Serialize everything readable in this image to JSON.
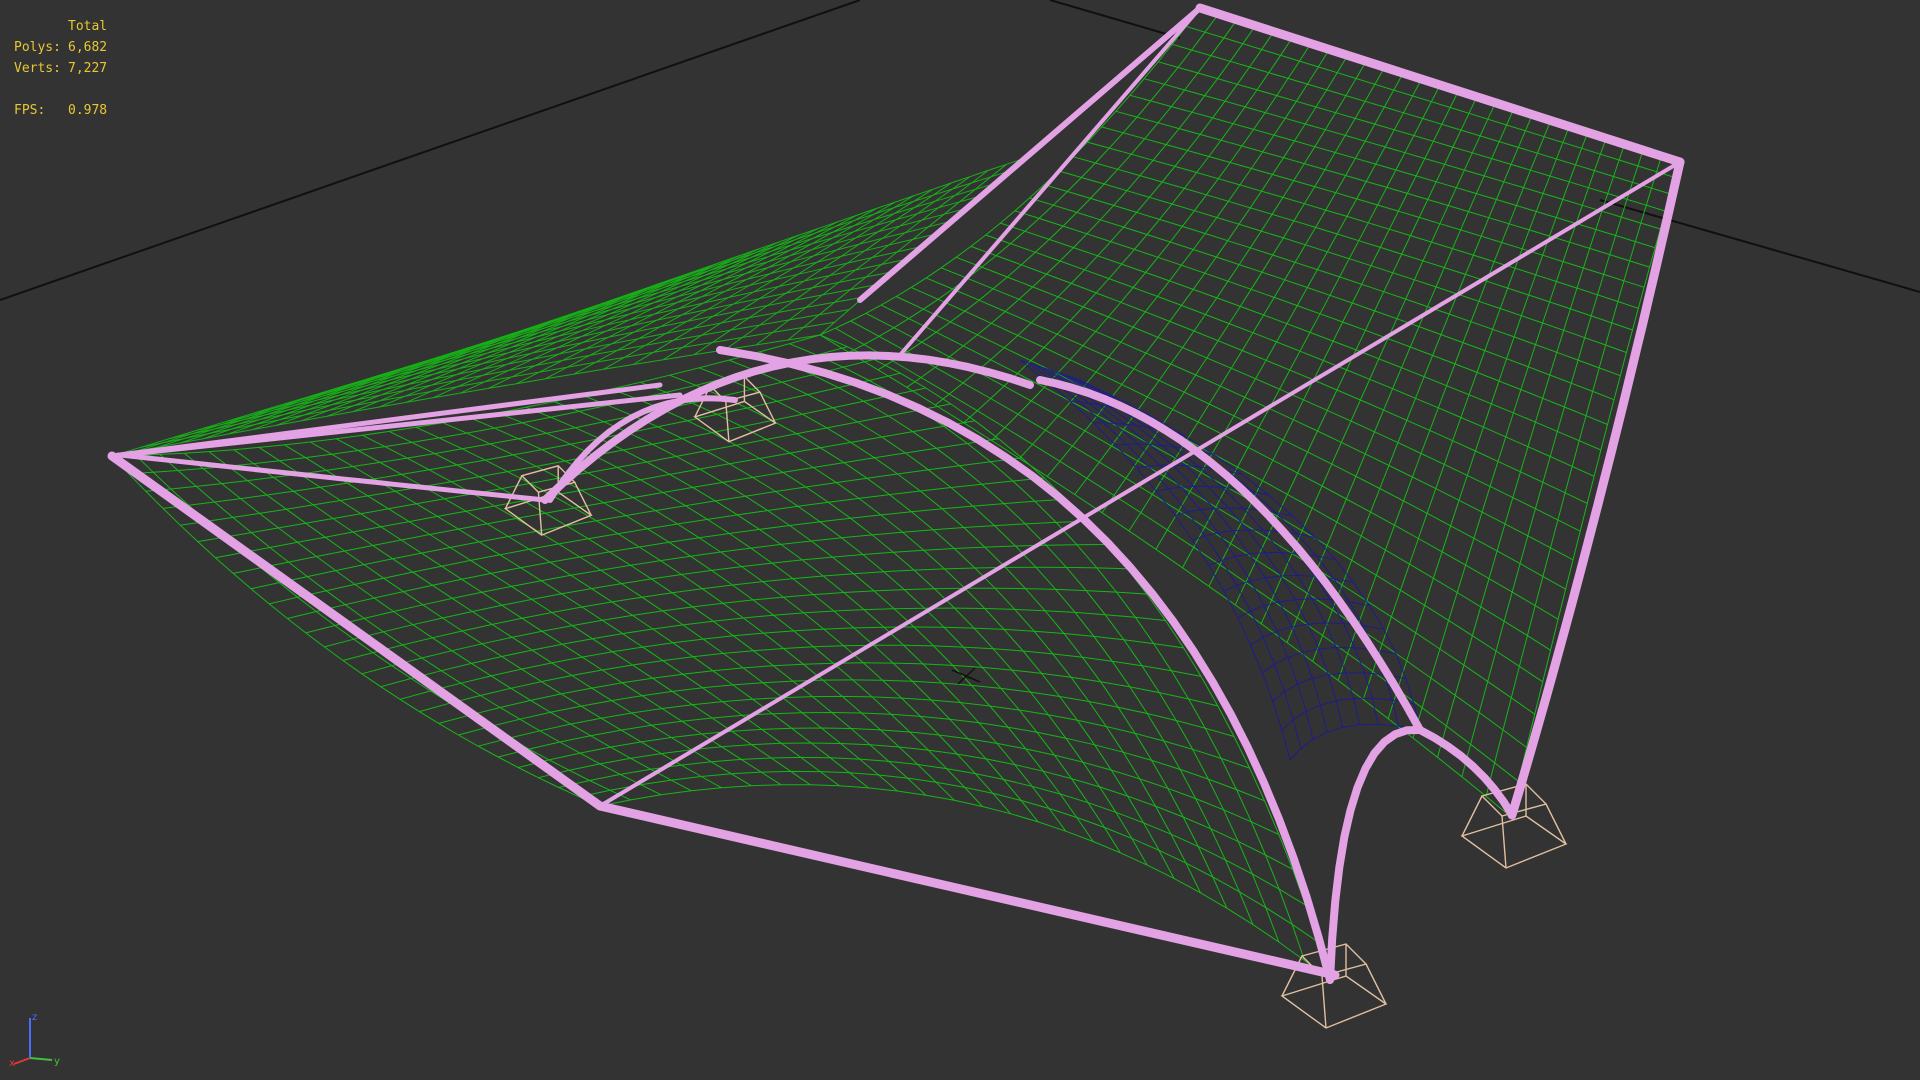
{
  "viewport": {
    "background_color": "#333333",
    "stats": {
      "header": "Total",
      "polys_label": "Polys:",
      "polys_value": "6,682",
      "verts_label": "Verts:",
      "verts_value": "7,227",
      "fps_label": "FPS:",
      "fps_value": "0.978",
      "text_color": "#e8c832"
    },
    "axis_gizmo": {
      "x_label": "x",
      "y_label": "y",
      "z_label": "z"
    },
    "colors": {
      "mesh": "#16b616",
      "mesh_underside": "#1c1a96",
      "frame": "#e2a2e4",
      "footing": "#e0c0a0",
      "ground_line": "#101010"
    },
    "object": {
      "name": "tensile membrane canopy",
      "mesh_type": "wireframe"
    }
  }
}
